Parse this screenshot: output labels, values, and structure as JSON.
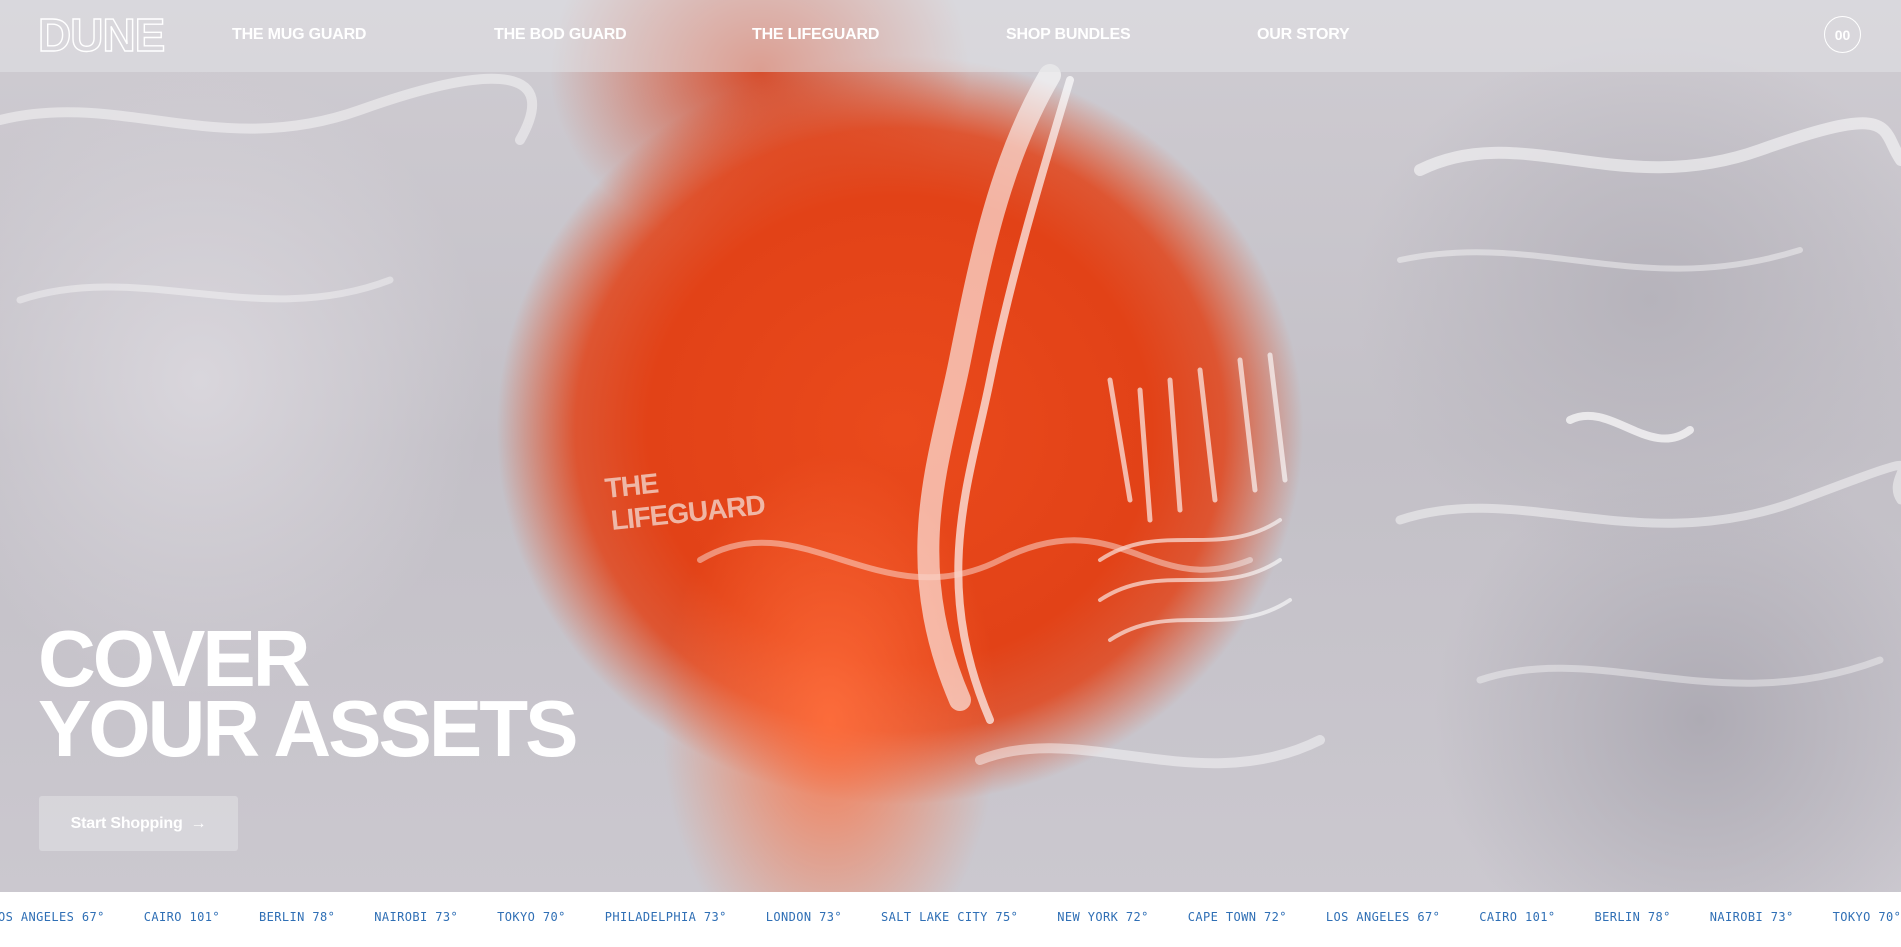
{
  "brand": {
    "logo_text": "DUNE"
  },
  "nav": {
    "items": [
      {
        "label": "THE MUG GUARD"
      },
      {
        "label": "THE BOD GUARD"
      },
      {
        "label": "THE LIFEGUARD"
      },
      {
        "label": "SHOP BUNDLES"
      },
      {
        "label": "OUR STORY"
      }
    ],
    "cart_count": "00"
  },
  "hero": {
    "headline_line1": "COVER",
    "headline_line2": "YOUR ASSETS",
    "cta_label": "Start Shopping",
    "cta_icon": "arrow-right-icon",
    "image_print": "THE LIFEGUARD"
  },
  "ticker": {
    "items": [
      "OS ANGELES 67°",
      "CAIRO 101°",
      "BERLIN 78°",
      "NAIROBI 73°",
      "TOKYO 70°",
      "PHILADELPHIA 73°",
      "LONDON 73°",
      "SALT LAKE CITY 75°",
      "NEW YORK 72°",
      "CAPE TOWN 72°",
      "LOS ANGELES 67°",
      "CAIRO 101°",
      "BERLIN 78°",
      "NAIROBI 73°",
      "TOKYO 70°"
    ]
  },
  "colors": {
    "ticker_text": "#2f6fb5",
    "product_orange": "#e24217",
    "water_grey": "#c8c5cc"
  }
}
